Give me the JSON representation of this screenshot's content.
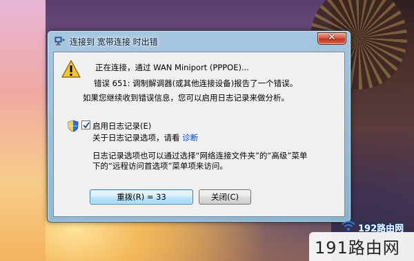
{
  "window": {
    "title": "连接到 宽带连接 时出错",
    "close_symbol": "✕"
  },
  "message": {
    "connecting": "正在连接，通过 WAN Miniport (PPPOE)...",
    "error": "错误 651: 调制解调器(或其他连接设备)报告了一个错误。",
    "hint": "如果您继续收到错误信息，您可以启用日志记录来做分析。"
  },
  "logging": {
    "checkbox_checked": true,
    "checkbox_label": "启用日志记录(E)",
    "about_text": "关于日志记录选项，请看",
    "diagnostics_link": "诊断",
    "note": "日志记录选项也可以通过选择“网络连接文件夹”的“高级”菜单下的“远程访问首选项”菜单项来访问。"
  },
  "buttons": {
    "retry": "重拨(R) = 33",
    "close": "关闭(C)"
  },
  "watermark": {
    "top": "192路由网",
    "main": "191路由网"
  },
  "icons": {
    "title": "network-connection-icon",
    "warning": "warning-icon",
    "shield": "uac-shield-icon",
    "close": "close-icon",
    "wifi": "wifi-icon"
  },
  "colors": {
    "link": "#0044cc",
    "close_button": "#c1331c",
    "default_button_border": "#3c7fb1"
  }
}
